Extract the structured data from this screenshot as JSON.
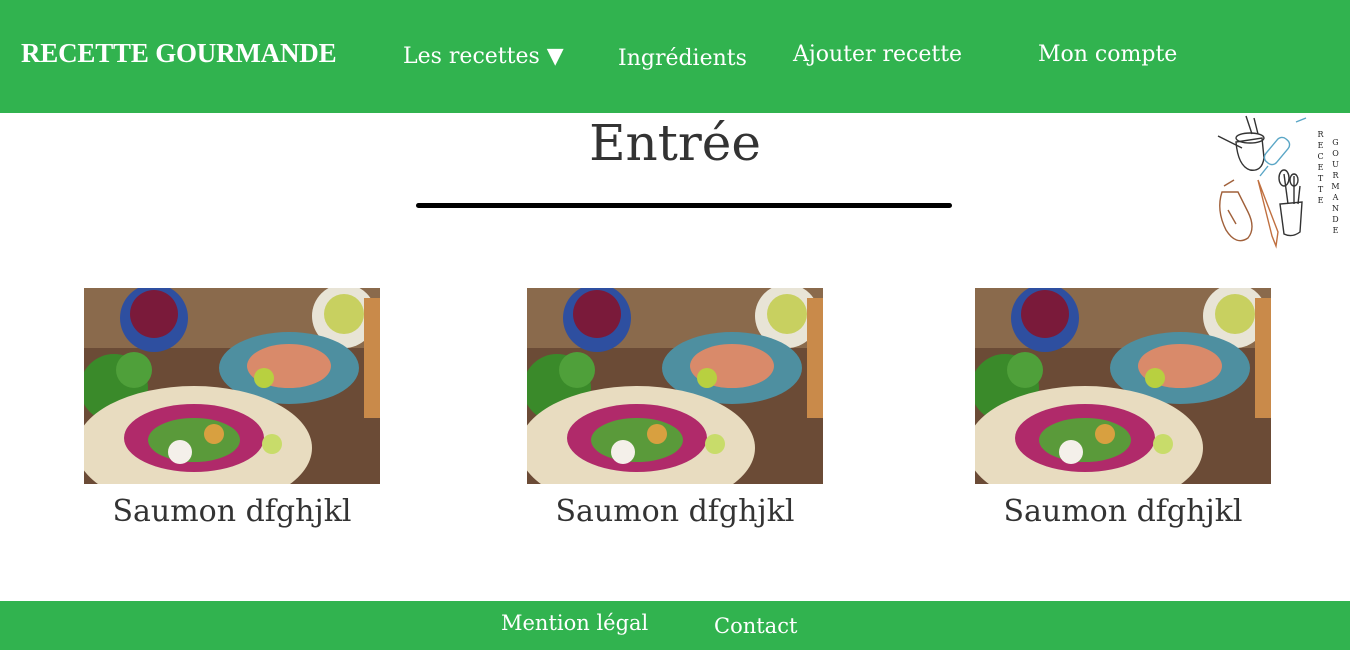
{
  "header": {
    "brand": "RECETTE GOURMANDE",
    "nav": {
      "recettes": "Les recettes ▼",
      "ingredients": "Ingrédients",
      "ajouter": "Ajouter recette",
      "compte": "Mon compte"
    }
  },
  "main": {
    "title": "Entrée",
    "cards": [
      {
        "title": "Saumon dfghjkl"
      },
      {
        "title": "Saumon dfghjkl"
      },
      {
        "title": "Saumon dfghjkl"
      }
    ]
  },
  "logo": {
    "word1": "RECETTE",
    "word2": "GOURMANDE"
  },
  "footer": {
    "mention": "Mention légal",
    "contact": "Contact"
  },
  "colors": {
    "brand_green": "#31b34f",
    "text_dark": "#333333"
  }
}
